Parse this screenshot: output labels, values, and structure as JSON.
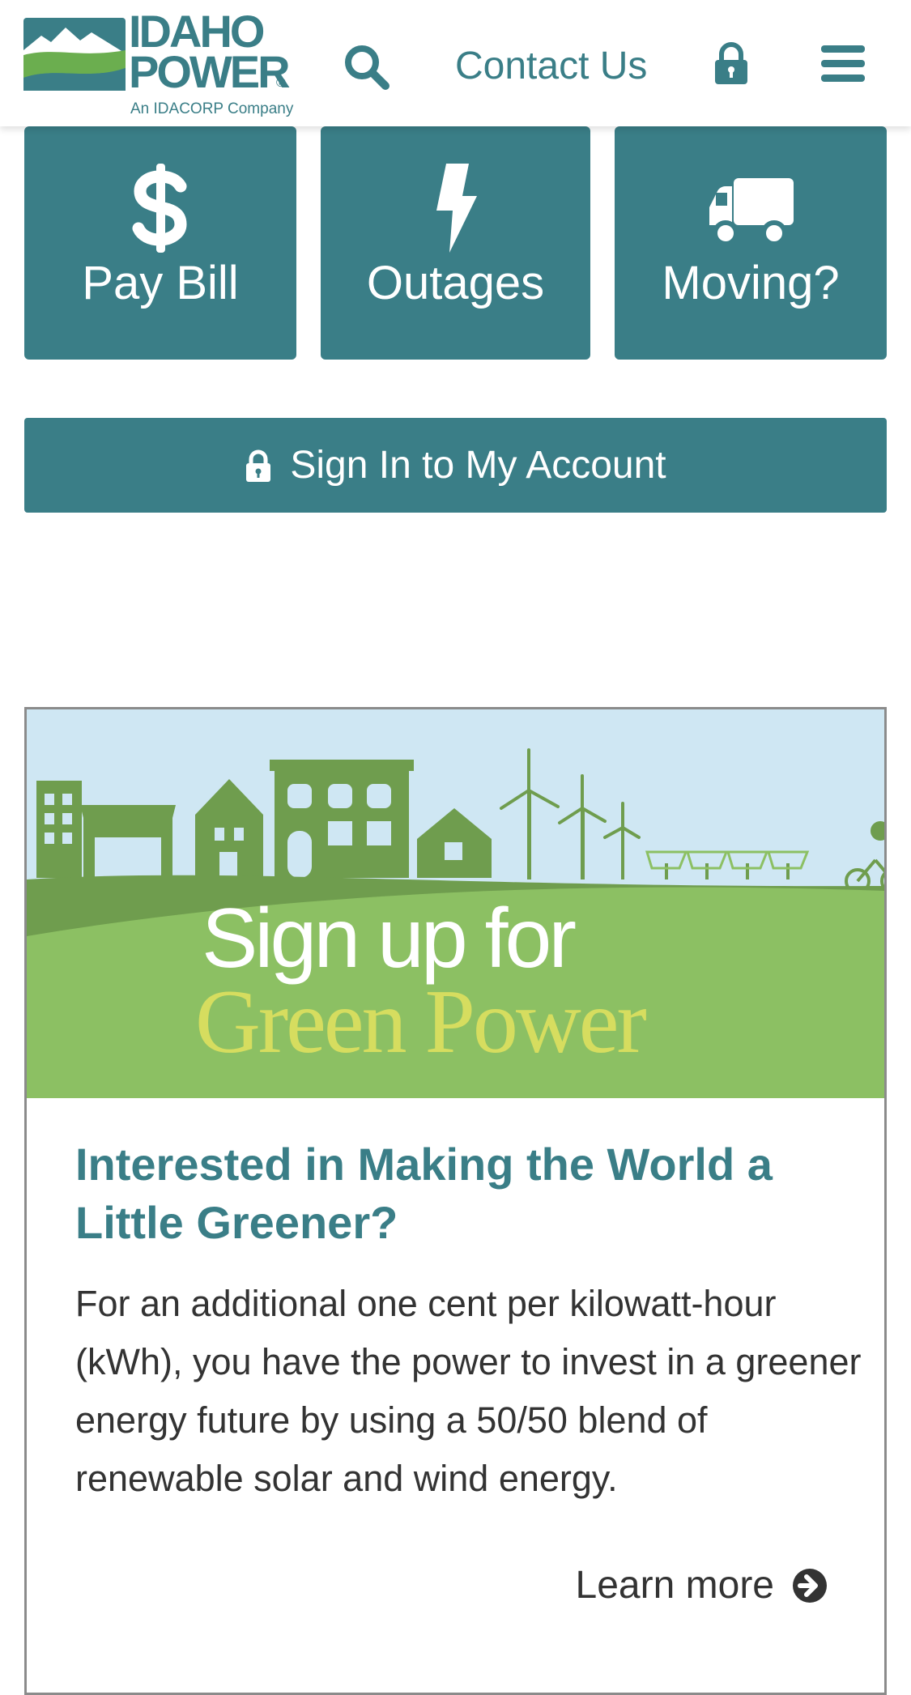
{
  "header": {
    "logo": {
      "wordmark_line1": "IDAHO",
      "wordmark_line2": "POWER",
      "registered": "®",
      "tagline": "An IDACORP Company"
    },
    "contact_label": "Contact Us",
    "icons": {
      "search": "search-icon",
      "lock": "lock-icon",
      "menu": "hamburger-menu-icon"
    }
  },
  "tiles": [
    {
      "label": "Pay Bill",
      "icon": "dollar-icon"
    },
    {
      "label": "Outages",
      "icon": "lightning-bolt-icon"
    },
    {
      "label": "Moving?",
      "icon": "truck-icon"
    }
  ],
  "signin": {
    "label": "Sign In to My Account",
    "icon": "lock-icon"
  },
  "promo": {
    "banner_line1": "Sign up for",
    "banner_line2": "Green Power",
    "title": "Interested in Making the World a Little Greener?",
    "body": "For an additional one cent per kilowatt-hour (kWh), you have the power to invest in a greener energy future by using a 50/50 blend of renewable solar and wind energy.",
    "link_label": "Learn more",
    "link_icon": "arrow-circle-right-icon"
  },
  "colors": {
    "brand_teal": "#3a7e87",
    "logo_green": "#6bae4f",
    "banner_sky": "#cfe7f3",
    "banner_grass": "#8cc063",
    "banner_building": "#6f9d4e",
    "banner_highlight": "#d6dd5f",
    "text_dark": "#333333"
  }
}
